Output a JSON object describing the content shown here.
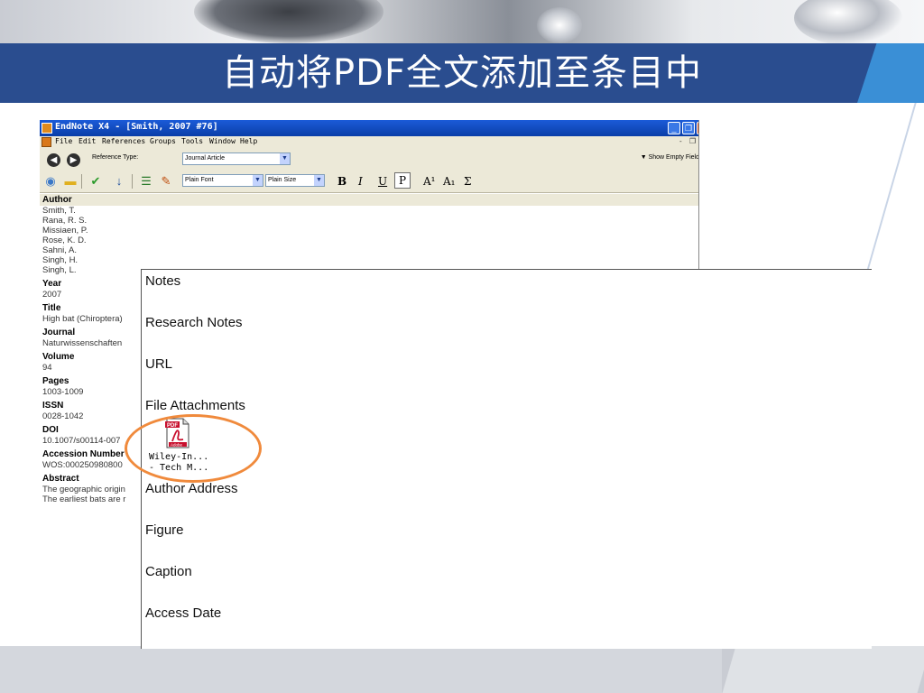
{
  "slide": {
    "title": "自动将PDF全文添加至条目中"
  },
  "window": {
    "title": "EndNote X4 - [Smith, 2007 #76]",
    "buttons": {
      "minimize": "_",
      "restore": "❐",
      "close": "✕"
    },
    "menu": [
      "File",
      "Edit",
      "References",
      "Groups",
      "Tools",
      "Window",
      "Help"
    ],
    "mdi_buttons": [
      "-",
      "❐"
    ]
  },
  "reference_type": {
    "label": "Reference Type:",
    "value": "Journal Article",
    "show_empty_fields": "Show Empty Field"
  },
  "toolbar": {
    "font": "Plain Font",
    "size": "Plain Size",
    "bold": "B",
    "italic": "I",
    "underline": "U",
    "plain": "P",
    "superscript": "A¹",
    "subscript": "A₁",
    "sigma": "Σ",
    "icons": [
      "globe-icon",
      "folder-icon",
      "checkmark-icon",
      "pin-icon",
      "list-icon",
      "link-icon"
    ]
  },
  "fields": {
    "author_label": "Author",
    "authors": [
      "Smith, T.",
      "Rana, R. S.",
      "Missiaen, P.",
      "Rose, K. D.",
      "Sahni, A.",
      "Singh, H.",
      "Singh, L."
    ],
    "year_label": "Year",
    "year": "2007",
    "title_label": "Title",
    "title": "High bat (Chiroptera)",
    "journal_label": "Journal",
    "journal": "Naturwissenschaften",
    "volume_label": "Volume",
    "volume": "94",
    "pages_label": "Pages",
    "pages": "1003-1009",
    "issn_label": "ISSN",
    "issn": "0028-1042",
    "doi_label": "DOI",
    "doi": "10.1007/s00114-007",
    "accession_label": "Accession Number",
    "accession": "WOS:000250980800",
    "abstract_label": "Abstract",
    "abstract_lines": [
      "The geographic origin",
      "The earliest bats are r"
    ]
  },
  "zoom_panel": {
    "notes": "Notes",
    "research_notes": "Research Notes",
    "url": "URL",
    "file_attachments": "File Attachments",
    "pdf_badge": "PDF",
    "adobe_badge": "Adobe",
    "attachment_line1": "Wiley-In...",
    "attachment_line2": "- Tech M...",
    "author_address": "Author Address",
    "figure": "Figure",
    "caption": "Caption",
    "access_date": "Access Date"
  },
  "colors": {
    "title_band": "#2a4d8f",
    "accent_blue": "#3a8fd6",
    "highlight_orange": "#f08a3c",
    "pdf_red": "#c8102e"
  }
}
